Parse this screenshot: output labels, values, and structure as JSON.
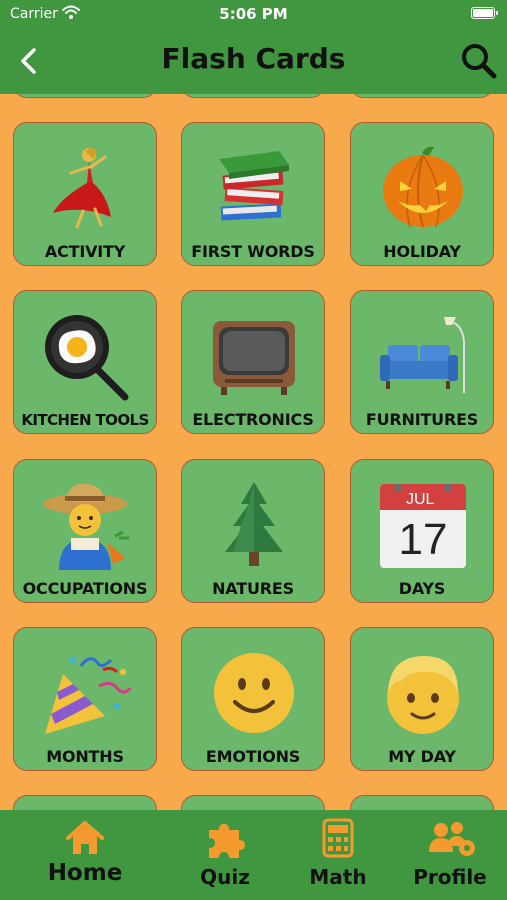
{
  "status_bar": {
    "carrier": "Carrier",
    "time": "5:06 PM"
  },
  "nav": {
    "title": "Flash Cards",
    "back_icon": "chevron-left-icon",
    "search_icon": "search-icon"
  },
  "cards": [
    {
      "label": "ACTIVITY",
      "icon": "dancer-icon"
    },
    {
      "label": "FIRST WORDS",
      "icon": "books-icon"
    },
    {
      "label": "HOLIDAY",
      "icon": "jack-o-lantern-icon"
    },
    {
      "label": "KITCHEN TOOLS",
      "icon": "frying-pan-egg-icon"
    },
    {
      "label": "ELECTRONICS",
      "icon": "television-icon"
    },
    {
      "label": "FURNITURES",
      "icon": "couch-lamp-icon"
    },
    {
      "label": "OCCUPATIONS",
      "icon": "farmer-icon"
    },
    {
      "label": "NATURES",
      "icon": "evergreen-tree-icon"
    },
    {
      "label": "DAYS",
      "icon": "calendar-icon"
    },
    {
      "label": "MONTHS",
      "icon": "party-popper-icon"
    },
    {
      "label": "EMOTIONS",
      "icon": "smiling-face-icon"
    },
    {
      "label": "MY DAY",
      "icon": "boy-face-icon"
    }
  ],
  "calendar_icon_text": {
    "month": "JUL",
    "day": "17"
  },
  "tabs": [
    {
      "label": "Home",
      "icon": "home-icon",
      "active": true
    },
    {
      "label": "Quiz",
      "icon": "puzzle-icon",
      "active": false
    },
    {
      "label": "Math",
      "icon": "calculator-icon",
      "active": false
    },
    {
      "label": "Profile",
      "icon": "users-gear-icon",
      "active": false
    }
  ],
  "colors": {
    "header": "#419640",
    "background": "#F7A94B",
    "card": "#6CB86B",
    "tab_icon": "#F49A2E"
  }
}
